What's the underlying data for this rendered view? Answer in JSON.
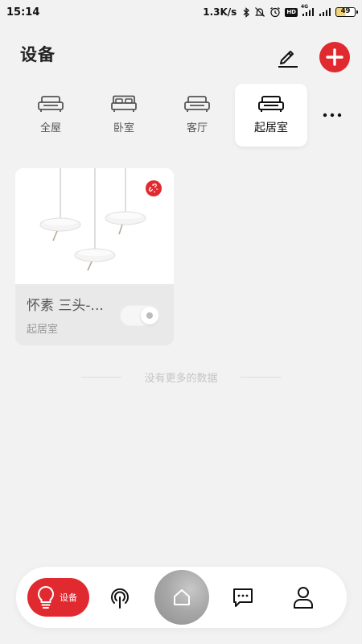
{
  "status_bar": {
    "time": "15:14",
    "net_speed": "1.3K/s",
    "network_type": "4G",
    "hd_label": "HD",
    "battery": "49",
    "icons": [
      "bluetooth-icon",
      "mute-bell-icon",
      "alarm-icon",
      "hd-icon",
      "signal-icon",
      "signal-icon",
      "battery-icon"
    ]
  },
  "header": {
    "title": "设备",
    "edit_icon": "pen-icon",
    "add_icon": "plus-icon"
  },
  "rooms": {
    "tabs": [
      {
        "label": "全屋",
        "icon": "sofa-icon",
        "active": false
      },
      {
        "label": "卧室",
        "icon": "bed-icon",
        "active": false
      },
      {
        "label": "客厅",
        "icon": "sofa-icon",
        "active": false
      },
      {
        "label": "起居室",
        "icon": "sofa-icon",
        "active": true
      }
    ],
    "more_icon": "more-dots-icon"
  },
  "devices": [
    {
      "name": "怀素 三头-...",
      "room": "起居室",
      "image": "pendant-lamp",
      "badge_icon": "unlink-icon",
      "toggle_on": false
    }
  ],
  "end_note": "没有更多的数据",
  "bottom_nav": {
    "devices_label": "设备",
    "items": [
      "bulb-icon",
      "broadcast-icon",
      "home-icon",
      "message-icon",
      "user-icon"
    ]
  },
  "colors": {
    "accent": "#e02a2f",
    "background": "#f2f2f2",
    "card_footer": "#e9e9e9"
  }
}
